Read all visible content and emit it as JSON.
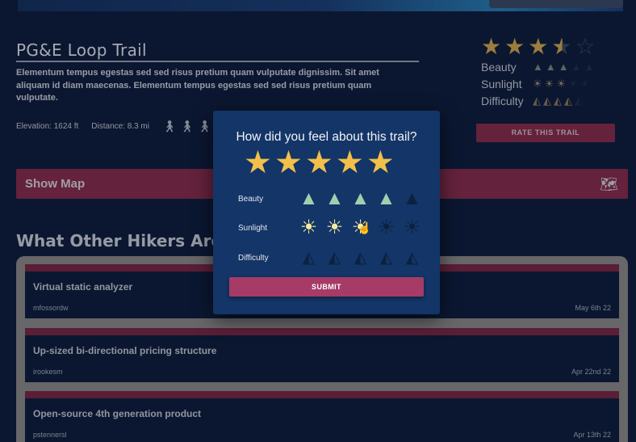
{
  "trail": {
    "title": "PG&E Loop Trail",
    "description": "Elementum tempus egestas sed sed risus pretium quam vulputate dignissim. Sit amet aliquam id diam maecenas. Elementum tempus egestas sed sed risus pretium quam vulputate.",
    "elevation": "Elevation: 1624 ft",
    "distance": "Distance: 8.3 mi",
    "difficulty_icons": [
      "hiker-icon",
      "hiker-icon",
      "hiker-icon"
    ]
  },
  "summary_rating": {
    "stars": 3.5,
    "max_stars": 5,
    "rows": [
      {
        "label": "Beauty",
        "icon": "tree-icon"
      },
      {
        "label": "Sunlight",
        "icon": "sun-icon"
      },
      {
        "label": "Difficulty",
        "icon": "mountain-icon"
      }
    ],
    "rate_button": "RATE THIS TRAIL"
  },
  "map": {
    "label": "Show Map",
    "icon": "map-icon"
  },
  "reviews": {
    "heading": "What Other Hikers Are S",
    "items": [
      {
        "title": "Virtual static analyzer",
        "user": "mfossordw",
        "date": "May 6th 22"
      },
      {
        "title": "Up-sized bi-directional pricing structure",
        "user": "irookesm",
        "date": "Apr 22nd 22"
      },
      {
        "title": "Open-source 4th generation product",
        "user": "pstennersl",
        "date": "Apr 13th 22"
      }
    ]
  },
  "modal": {
    "question": "How did you feel about this trail?",
    "stars_selected": 5,
    "stars_max": 5,
    "rows": [
      {
        "label": "Beauty",
        "icon": "tree-icon",
        "selected": 4,
        "max": 5
      },
      {
        "label": "Sunlight",
        "icon": "sun-icon",
        "selected": 3,
        "max": 5
      },
      {
        "label": "Difficulty",
        "icon": "mountain-icon",
        "selected": 0,
        "max": 5
      }
    ],
    "submit": "SUBMIT"
  },
  "colors": {
    "background": "#0f1c3a",
    "accent": "#8a2b48",
    "modal": "#133567",
    "star": "#f2c04a"
  }
}
